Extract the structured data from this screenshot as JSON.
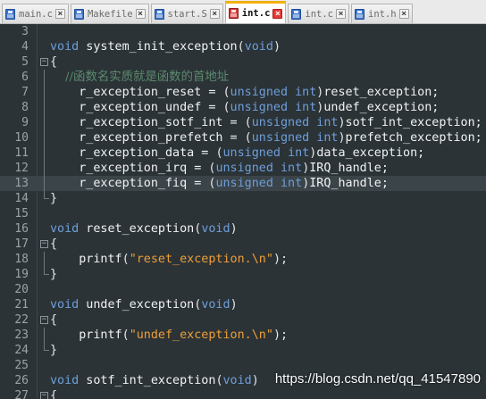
{
  "tabs": [
    {
      "label": "main.c",
      "state": "saved"
    },
    {
      "label": "Makefile",
      "state": "saved"
    },
    {
      "label": "start.S",
      "state": "saved"
    },
    {
      "label": "int.c",
      "state": "active"
    },
    {
      "label": "int.c",
      "state": "saved"
    },
    {
      "label": "int.h",
      "state": "saved"
    }
  ],
  "close_glyph": "×",
  "editor": {
    "current_line": 13,
    "lines": [
      {
        "n": "3",
        "tokens": []
      },
      {
        "n": "4",
        "tokens": [
          [
            "kw",
            "void"
          ],
          [
            "fn",
            " system_init_exception"
          ],
          [
            "punc",
            "("
          ],
          [
            "kw",
            "void"
          ],
          [
            "punc",
            ")"
          ]
        ]
      },
      {
        "n": "5",
        "fold": "open",
        "tokens": [
          [
            "punc",
            "{"
          ]
        ]
      },
      {
        "n": "6",
        "fold": "bar",
        "tokens": [
          [
            "cmt",
            "    //函数名实质就是函数的首地址"
          ]
        ]
      },
      {
        "n": "7",
        "fold": "bar",
        "tokens": [
          [
            "fn",
            "    r_exception_reset = "
          ],
          [
            "punc",
            "("
          ],
          [
            "kw",
            "unsigned"
          ],
          [
            "fn",
            " "
          ],
          [
            "kw",
            "int"
          ],
          [
            "punc",
            ")"
          ],
          [
            "fn",
            "reset_exception;"
          ]
        ]
      },
      {
        "n": "8",
        "fold": "bar",
        "tokens": [
          [
            "fn",
            "    r_exception_undef = "
          ],
          [
            "punc",
            "("
          ],
          [
            "kw",
            "unsigned"
          ],
          [
            "fn",
            " "
          ],
          [
            "kw",
            "int"
          ],
          [
            "punc",
            ")"
          ],
          [
            "fn",
            "undef_exception;"
          ]
        ]
      },
      {
        "n": "9",
        "fold": "bar",
        "tokens": [
          [
            "fn",
            "    r_exception_sotf_int = "
          ],
          [
            "punc",
            "("
          ],
          [
            "kw",
            "unsigned"
          ],
          [
            "fn",
            " "
          ],
          [
            "kw",
            "int"
          ],
          [
            "punc",
            ")"
          ],
          [
            "fn",
            "sotf_int_exception;"
          ]
        ]
      },
      {
        "n": "10",
        "fold": "bar",
        "tokens": [
          [
            "fn",
            "    r_exception_prefetch = "
          ],
          [
            "punc",
            "("
          ],
          [
            "kw",
            "unsigned"
          ],
          [
            "fn",
            " "
          ],
          [
            "kw",
            "int"
          ],
          [
            "punc",
            ")"
          ],
          [
            "fn",
            "prefetch_exception;"
          ]
        ]
      },
      {
        "n": "11",
        "fold": "bar",
        "tokens": [
          [
            "fn",
            "    r_exception_data = "
          ],
          [
            "punc",
            "("
          ],
          [
            "kw",
            "unsigned"
          ],
          [
            "fn",
            " "
          ],
          [
            "kw",
            "int"
          ],
          [
            "punc",
            ")"
          ],
          [
            "fn",
            "data_exception;"
          ]
        ]
      },
      {
        "n": "12",
        "fold": "bar",
        "tokens": [
          [
            "fn",
            "    r_exception_irq = "
          ],
          [
            "punc",
            "("
          ],
          [
            "kw",
            "unsigned"
          ],
          [
            "fn",
            " "
          ],
          [
            "kw",
            "int"
          ],
          [
            "punc",
            ")"
          ],
          [
            "fn",
            "IRQ_handle;"
          ]
        ]
      },
      {
        "n": "13",
        "fold": "bar",
        "tokens": [
          [
            "fn",
            "    r_exception_fiq = "
          ],
          [
            "punc",
            "("
          ],
          [
            "kw",
            "unsigned"
          ],
          [
            "fn",
            " "
          ],
          [
            "kw",
            "int"
          ],
          [
            "punc",
            ")"
          ],
          [
            "fn",
            "IRQ_handle;"
          ]
        ]
      },
      {
        "n": "14",
        "fold": "end",
        "tokens": [
          [
            "punc",
            "}"
          ]
        ]
      },
      {
        "n": "15",
        "tokens": []
      },
      {
        "n": "16",
        "tokens": [
          [
            "kw",
            "void"
          ],
          [
            "fn",
            " reset_exception"
          ],
          [
            "punc",
            "("
          ],
          [
            "kw",
            "void"
          ],
          [
            "punc",
            ")"
          ]
        ]
      },
      {
        "n": "17",
        "fold": "open",
        "tokens": [
          [
            "punc",
            "{"
          ]
        ]
      },
      {
        "n": "18",
        "fold": "bar",
        "tokens": [
          [
            "fn",
            "    printf"
          ],
          [
            "punc",
            "("
          ],
          [
            "str",
            "\"reset_exception.\\n\""
          ],
          [
            "punc",
            ");"
          ]
        ]
      },
      {
        "n": "19",
        "fold": "end",
        "tokens": [
          [
            "punc",
            "}"
          ]
        ]
      },
      {
        "n": "20",
        "tokens": []
      },
      {
        "n": "21",
        "tokens": [
          [
            "kw",
            "void"
          ],
          [
            "fn",
            " undef_exception"
          ],
          [
            "punc",
            "("
          ],
          [
            "kw",
            "void"
          ],
          [
            "punc",
            ")"
          ]
        ]
      },
      {
        "n": "22",
        "fold": "open",
        "tokens": [
          [
            "punc",
            "{"
          ]
        ]
      },
      {
        "n": "23",
        "fold": "bar",
        "tokens": [
          [
            "fn",
            "    printf"
          ],
          [
            "punc",
            "("
          ],
          [
            "str",
            "\"undef_exception.\\n\""
          ],
          [
            "punc",
            ");"
          ]
        ]
      },
      {
        "n": "24",
        "fold": "end",
        "tokens": [
          [
            "punc",
            "}"
          ]
        ]
      },
      {
        "n": "25",
        "tokens": []
      },
      {
        "n": "26",
        "tokens": [
          [
            "kw",
            "void"
          ],
          [
            "fn",
            " sotf_int_exception"
          ],
          [
            "punc",
            "("
          ],
          [
            "kw",
            "void"
          ],
          [
            "punc",
            ")"
          ]
        ]
      },
      {
        "n": "27",
        "fold": "open",
        "tokens": [
          [
            "punc",
            "{"
          ]
        ]
      }
    ]
  },
  "watermark": "https://blog.csdn.net/qq_41547890",
  "colors": {
    "background": "#2b3337",
    "keyword": "#6f9ed9",
    "string": "#ee9f38",
    "comment": "#5c8a6e",
    "active_tab_accent": "#f0b000"
  }
}
